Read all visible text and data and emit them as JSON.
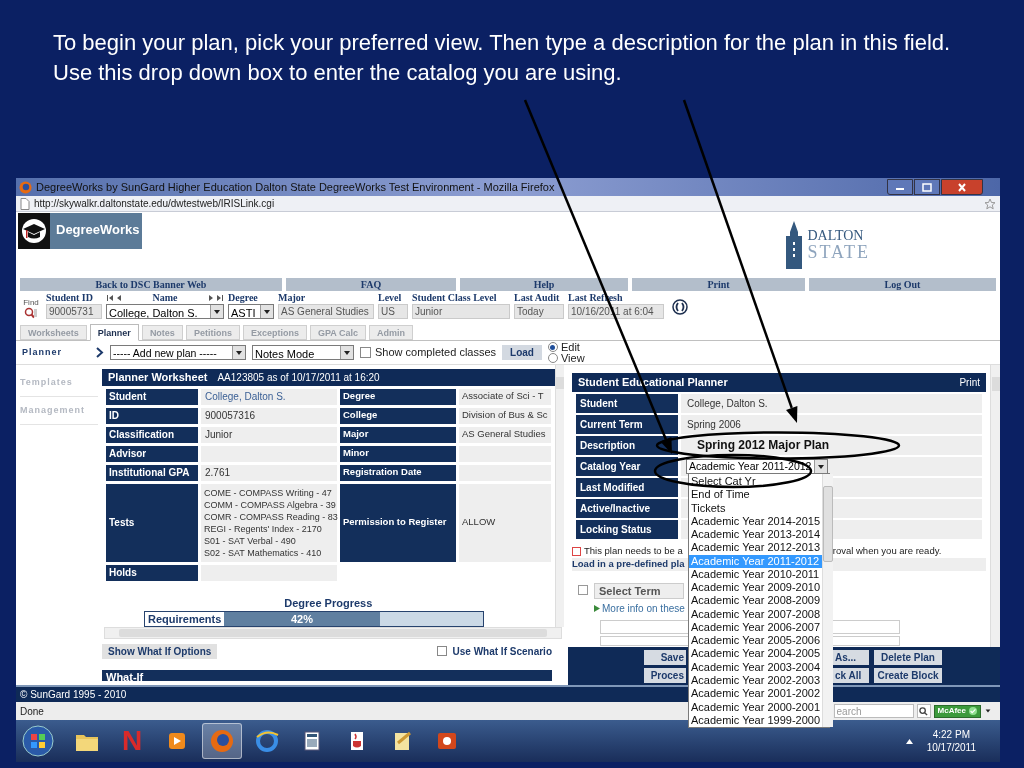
{
  "slide": {
    "caption": "To begin your plan, pick your preferred view.  Then type a description for the plan in this field.  Use this drop down box to enter the catalog you are using."
  },
  "browser": {
    "title": "DegreeWorks by SunGard Higher Education Dalton State DegreeWorks Test Environment - Mozilla Firefox",
    "url": "http://skywalkr.daltonstate.edu/dwtestweb/IRISLink.cgi",
    "status": "Done",
    "search_placeholder": "earch",
    "addon": "McAfee"
  },
  "header": {
    "logo": "DegreeWorks",
    "school": [
      "DALTON",
      "STATE"
    ]
  },
  "nav": [
    "Back to DSC Banner Web",
    "FAQ",
    "Help",
    "Print",
    "Log Out"
  ],
  "student_bar": {
    "find": "Find",
    "fields": [
      {
        "label": "Student ID",
        "value": "90005731",
        "kind": "text"
      },
      {
        "label": "Name",
        "value": "College, Dalton S.",
        "kind": "select",
        "pager": true
      },
      {
        "label": "Degree",
        "value": "ASTI",
        "kind": "select"
      },
      {
        "label": "Major",
        "value": "AS General Studies",
        "kind": "text"
      },
      {
        "label": "Level",
        "value": "US",
        "kind": "text"
      },
      {
        "label": "Student Class Level",
        "value": "Junior",
        "kind": "text"
      },
      {
        "label": "Last Audit",
        "value": "Today",
        "kind": "text"
      },
      {
        "label": "Last Refresh",
        "value": "10/16/2011 at 6:04",
        "kind": "text"
      }
    ]
  },
  "tabs": [
    {
      "label": "Worksheets",
      "selected": false
    },
    {
      "label": "Planner",
      "selected": true
    },
    {
      "label": "Notes",
      "selected": false
    },
    {
      "label": "Petitions",
      "selected": false
    },
    {
      "label": "Exceptions",
      "selected": false
    },
    {
      "label": "GPA Calc",
      "selected": false
    },
    {
      "label": "Admin",
      "selected": false
    }
  ],
  "planner_bar": {
    "section": "Planner",
    "plan_select": "----- Add new plan -----",
    "mode_select": "Notes Mode",
    "show_completed": {
      "label": "Show completed classes",
      "checked": false
    },
    "load": "Load",
    "views": [
      {
        "label": "Edit",
        "selected": true
      },
      {
        "label": "View",
        "selected": false
      }
    ]
  },
  "side_menu": [
    "Templates",
    "Management"
  ],
  "worksheet": {
    "title": "Planner Worksheet",
    "subtitle": "AA123805 as of 10/17/2011 at 16:20",
    "rows": [
      {
        "label": "Student",
        "value": "College, Dalton S.",
        "link": true,
        "label2": "Degree",
        "value2": "Associate of Sci - T"
      },
      {
        "label": "ID",
        "value": "900057316",
        "label2": "College",
        "value2": "Division of Bus & Sc"
      },
      {
        "label": "Classification",
        "value": "Junior",
        "label2": "Major",
        "value2": "AS General Studies"
      },
      {
        "label": "Advisor",
        "label2": "Minor"
      },
      {
        "label": "Institutional GPA",
        "value": "2.761",
        "label2": "Registration Date"
      },
      {
        "label": "Tests",
        "lines": [
          "COME - COMPASS Writing - 47",
          "COMM - COMPASS Algebra - 39",
          "COMR - COMPASS Reading - 83",
          "REGI - Regents' Index - 2170",
          "S01 - SAT Verbal - 490",
          "S02 - SAT Mathematics - 410"
        ],
        "label2": "Permission to Register",
        "value2": "ALLOW"
      },
      {
        "label": "Holds"
      }
    ],
    "progress": {
      "title": "Degree Progress",
      "label": "Requirements",
      "reading": "42%",
      "level": 0.6
    },
    "what_if_button": "Show What If Options",
    "scenario": {
      "label": "Use What If Scenario",
      "checked": false
    },
    "what_if_title": "What-If"
  },
  "planner": {
    "title": "Student Educational Planner",
    "print": "Print",
    "rows": [
      {
        "label": "Student",
        "value": "College, Dalton S.",
        "kind": "text"
      },
      {
        "label": "Current Term",
        "value": "Spring 2006",
        "kind": "text"
      },
      {
        "label": "Description",
        "value": "Spring 2012 Major Plan",
        "kind": "input"
      },
      {
        "label": "Catalog Year",
        "value": "Academic Year 2011-2012",
        "kind": "select"
      },
      {
        "label": "Last Modified",
        "kind": "text"
      },
      {
        "label": "Active/Inactive",
        "kind": "text"
      },
      {
        "label": "Locking Status",
        "kind": "text"
      }
    ],
    "approval": {
      "before": "This plan needs to be a",
      "after": "roval when you are ready.",
      "checked": false
    },
    "predefined": "Load in a pre-defined pla",
    "term": {
      "checked": false,
      "select": "Select Term",
      "info_link": "More info on these"
    },
    "buttons": [
      [
        "Save",
        "As...",
        "Delete Plan"
      ],
      [
        "Proces",
        "ck All",
        "Create Block"
      ]
    ]
  },
  "catalog_options": [
    {
      "label": "Select Cat Yr",
      "selected": false
    },
    {
      "label": "End of Time",
      "selected": false
    },
    {
      "label": "Tickets",
      "selected": false
    },
    {
      "label": "Academic Year 2014-2015",
      "selected": false
    },
    {
      "label": "Academic Year 2013-2014",
      "selected": false
    },
    {
      "label": "Academic Year 2012-2013",
      "selected": false
    },
    {
      "label": "Academic Year 2011-2012",
      "selected": true
    },
    {
      "label": "Academic Year 2010-2011",
      "selected": false
    },
    {
      "label": "Academic Year 2009-2010",
      "selected": false
    },
    {
      "label": "Academic Year 2008-2009",
      "selected": false
    },
    {
      "label": "Academic Year 2007-2008",
      "selected": false
    },
    {
      "label": "Academic Year 2006-2007",
      "selected": false
    },
    {
      "label": "Academic Year 2005-2006",
      "selected": false
    },
    {
      "label": "Academic Year 2004-2005",
      "selected": false
    },
    {
      "label": "Academic Year 2003-2004",
      "selected": false
    },
    {
      "label": "Academic Year 2002-2003",
      "selected": false
    },
    {
      "label": "Academic Year 2001-2002",
      "selected": false
    },
    {
      "label": "Academic Year 2000-2001",
      "selected": false
    },
    {
      "label": "Academic Year 1999-2000",
      "selected": false
    }
  ],
  "footer": "© SunGard 1995 - 2010",
  "taskbar": {
    "apps": [
      {
        "selected": false
      },
      {
        "selected": false,
        "glyph": "N"
      },
      {
        "selected": false
      },
      {
        "selected": true
      },
      {
        "selected": false
      },
      {
        "selected": false
      },
      {
        "selected": false
      },
      {
        "selected": false
      },
      {
        "selected": false
      }
    ],
    "time": "4:22 PM",
    "date": "10/17/2011"
  }
}
